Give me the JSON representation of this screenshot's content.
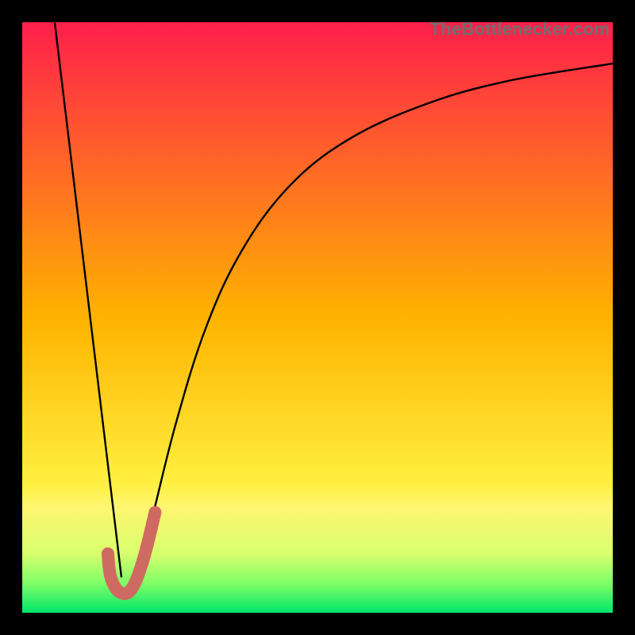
{
  "watermark": {
    "text": "TheBottlenecker.com"
  },
  "chart_data": {
    "type": "line",
    "title": "",
    "xlabel": "",
    "ylabel": "",
    "xlim": [
      0,
      100
    ],
    "ylim": [
      0,
      100
    ],
    "gradient_stops": [
      {
        "offset": 0,
        "color": "#ff1f4b"
      },
      {
        "offset": 0.5,
        "color": "#ffb300"
      },
      {
        "offset": 0.78,
        "color": "#ffef3f"
      },
      {
        "offset": 0.82,
        "color": "#fff670"
      },
      {
        "offset": 0.9,
        "color": "#d8ff6e"
      },
      {
        "offset": 0.95,
        "color": "#7fff66"
      },
      {
        "offset": 1.0,
        "color": "#00e56a"
      }
    ],
    "series": [
      {
        "name": "left-drop",
        "type": "polyline",
        "stroke": "#000000",
        "width": 2.4,
        "points": [
          {
            "x": 5.5,
            "y": 100
          },
          {
            "x": 16.8,
            "y": 6
          }
        ]
      },
      {
        "name": "right-rise",
        "type": "curve",
        "stroke": "#000000",
        "width": 2.4,
        "points": [
          {
            "x": 19.0,
            "y": 4
          },
          {
            "x": 22.0,
            "y": 16
          },
          {
            "x": 26.0,
            "y": 32
          },
          {
            "x": 31.0,
            "y": 48
          },
          {
            "x": 37.0,
            "y": 61
          },
          {
            "x": 45.0,
            "y": 72
          },
          {
            "x": 55.0,
            "y": 80
          },
          {
            "x": 68.0,
            "y": 86
          },
          {
            "x": 82.0,
            "y": 90
          },
          {
            "x": 100.0,
            "y": 93
          }
        ]
      },
      {
        "name": "j-hook",
        "type": "curve",
        "stroke": "#cf6a62",
        "width": 16,
        "linecap": "round",
        "points": [
          {
            "x": 14.5,
            "y": 10
          },
          {
            "x": 15.0,
            "y": 6
          },
          {
            "x": 16.5,
            "y": 3.5
          },
          {
            "x": 18.5,
            "y": 4
          },
          {
            "x": 20.5,
            "y": 9
          },
          {
            "x": 22.5,
            "y": 17
          }
        ]
      }
    ]
  }
}
